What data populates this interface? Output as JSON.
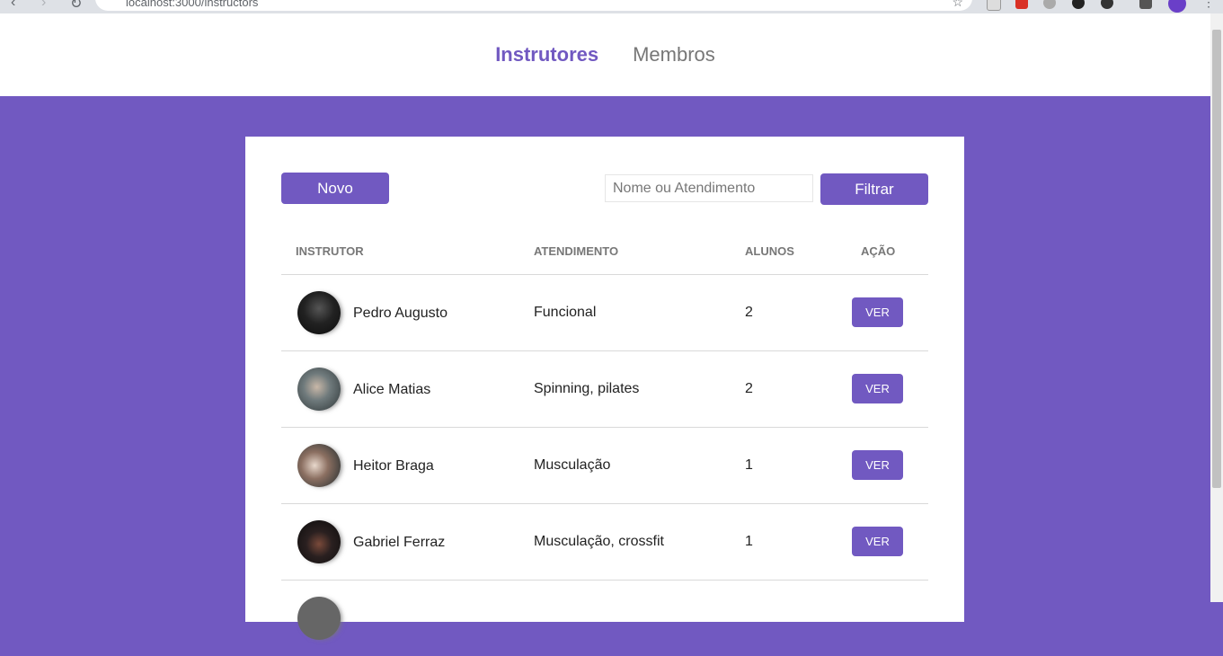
{
  "browser": {
    "url": "localhost:3000/instructors"
  },
  "nav": {
    "instructors": "Instrutores",
    "members": "Membros"
  },
  "toolbar": {
    "new_label": "Novo",
    "search_placeholder": "Nome ou Atendimento",
    "filter_label": "Filtrar"
  },
  "table": {
    "headers": [
      "INSTRUTOR",
      "ATENDIMENTO",
      "ALUNOS",
      "AÇÃO"
    ],
    "rows": [
      {
        "name": "Pedro Augusto",
        "service": "Funcional",
        "students": "2",
        "action": "VER"
      },
      {
        "name": "Alice Matias",
        "service": "Spinning, pilates",
        "students": "2",
        "action": "VER"
      },
      {
        "name": "Heitor Braga",
        "service": "Musculação",
        "students": "1",
        "action": "VER"
      },
      {
        "name": "Gabriel Ferraz",
        "service": "Musculação, crossfit",
        "students": "1",
        "action": "VER"
      }
    ]
  },
  "colors": {
    "primary": "#7159c1",
    "background": "#7159c1"
  }
}
